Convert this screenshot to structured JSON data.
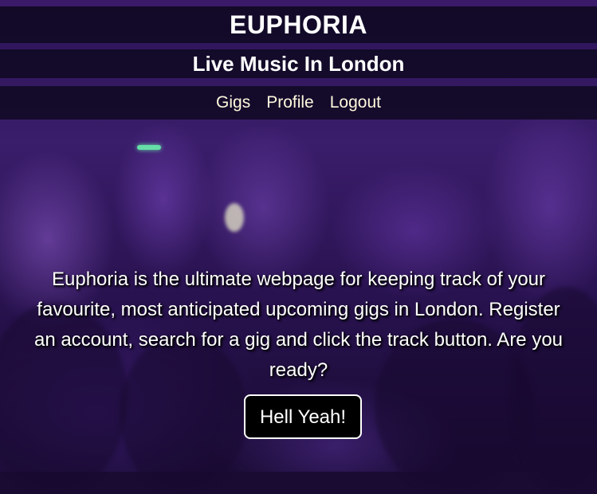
{
  "header": {
    "title": "EUPHORIA",
    "subtitle": "Live Music In London"
  },
  "nav": {
    "items": [
      {
        "label": "Gigs"
      },
      {
        "label": "Profile"
      },
      {
        "label": "Logout"
      }
    ]
  },
  "main": {
    "intro": "Euphoria is the ultimate webpage for keeping track of your favourite, most anticipated upcoming gigs in London. Register an account, search for a gig and click the track button. Are you ready?",
    "cta_label": "Hell Yeah!"
  },
  "colors": {
    "background": "#2c1356",
    "nav_link": "#fff8dc",
    "button_bg": "#000000",
    "button_border": "#ffffff"
  }
}
